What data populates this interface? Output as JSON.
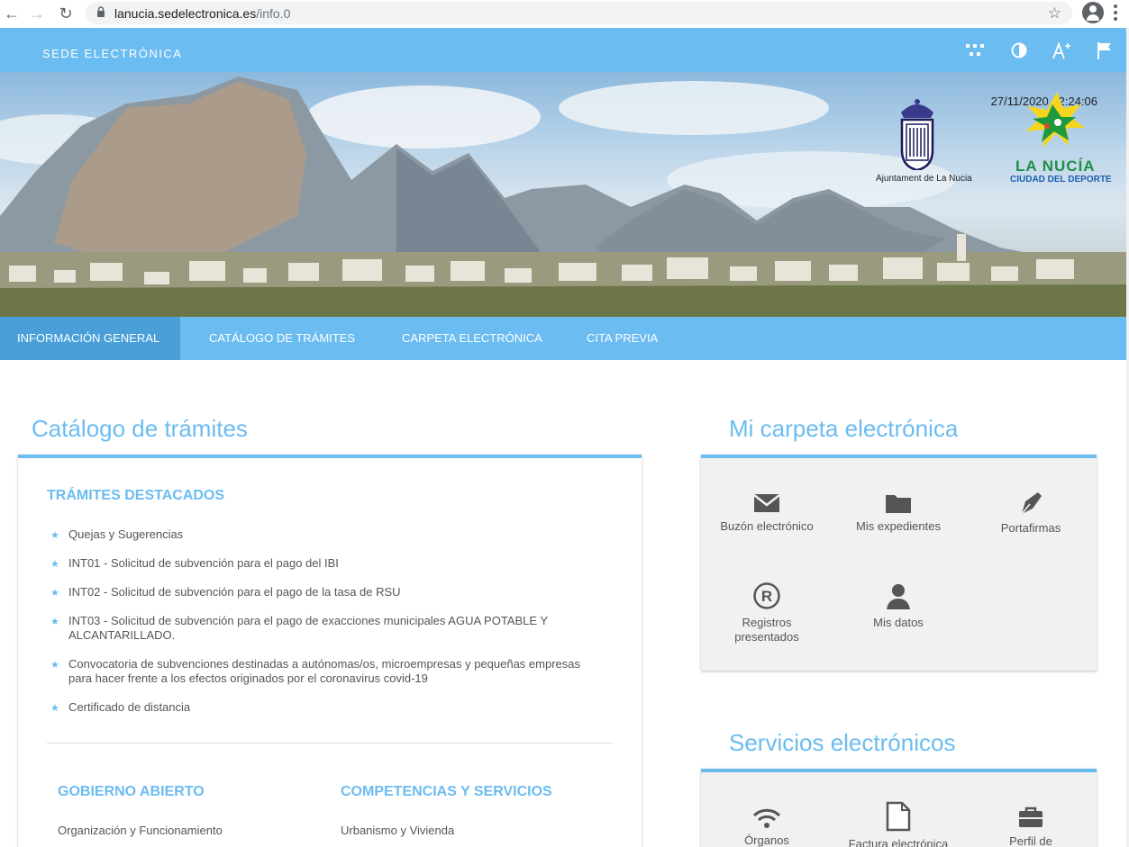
{
  "browser": {
    "url_domain": "lanucia.sedelectronica.es",
    "url_path": "/info.0"
  },
  "topbar": {
    "brand": "SEDE ELECTRÓNICA"
  },
  "banner": {
    "datetime": "27/11/2020 12:24:06",
    "council_label": "Ajuntament de La Nucia",
    "town_title": "LA NUCÍA",
    "town_subtitle": "CIUDAD DEL DEPORTE"
  },
  "nav": {
    "items": [
      {
        "label": "INFORMACIÓN GENERAL",
        "active": true
      },
      {
        "label": "CATÁLOGO DE TRÁMITES",
        "active": false
      },
      {
        "label": "CARPETA ELECTRÓNICA",
        "active": false
      },
      {
        "label": "CITA PREVIA",
        "active": false
      }
    ]
  },
  "catalog": {
    "title": "Catálogo de trámites",
    "featured_heading": "TRÁMITES DESTACADOS",
    "featured": [
      {
        "line1": "Quejas y Sugerencias",
        "line2": ""
      },
      {
        "line1": "INT01 - Solicitud de subvención para el pago del IBI",
        "line2": ""
      },
      {
        "line1": "INT02 - Solicitud de subvención para el pago de la tasa de RSU",
        "line2": ""
      },
      {
        "line1": "INT03 - Solicitud de subvención para el pago de exacciones municipales AGUA POTABLE Y",
        "line2": "ALCANTARILLADO."
      },
      {
        "line1": "Convocatoria de subvenciones destinadas a autónomas/os, microempresas y pequeñas empresas",
        "line2": "para hacer frente a los efectos originados por el coronavirus covid-19"
      },
      {
        "line1": "Certificado de distancia",
        "line2": ""
      }
    ],
    "gov_heading": "GOBIERNO ABIERTO",
    "gov_item": "Organización y Funcionamiento",
    "comp_heading": "COMPETENCIAS Y SERVICIOS",
    "comp_item": "Urbanismo y Vivienda"
  },
  "carpeta": {
    "title": "Mi carpeta electrónica",
    "tiles": [
      {
        "line1": "Buzón electrónico",
        "line2": "",
        "icon": "envelope-icon"
      },
      {
        "line1": "Mis expedientes",
        "line2": "",
        "icon": "folder-icon"
      },
      {
        "line1": "Portafirmas",
        "line2": "",
        "icon": "pen-icon"
      },
      {
        "line1": "Registros",
        "line2": "presentados",
        "icon": "registered-icon"
      },
      {
        "line1": "Mis datos",
        "line2": "",
        "icon": "user-icon"
      }
    ]
  },
  "servicios": {
    "title": "Servicios electrónicos",
    "tiles": [
      {
        "label": "Órganos",
        "icon": "signal-icon"
      },
      {
        "label": "Factura electrónica",
        "icon": "document-icon"
      },
      {
        "label": "Perfil de",
        "icon": "briefcase-icon"
      }
    ]
  },
  "colors": {
    "accent": "#6bbcf0",
    "nav_active": "#4a9fd9",
    "panel_grey": "#f1f1f1"
  }
}
